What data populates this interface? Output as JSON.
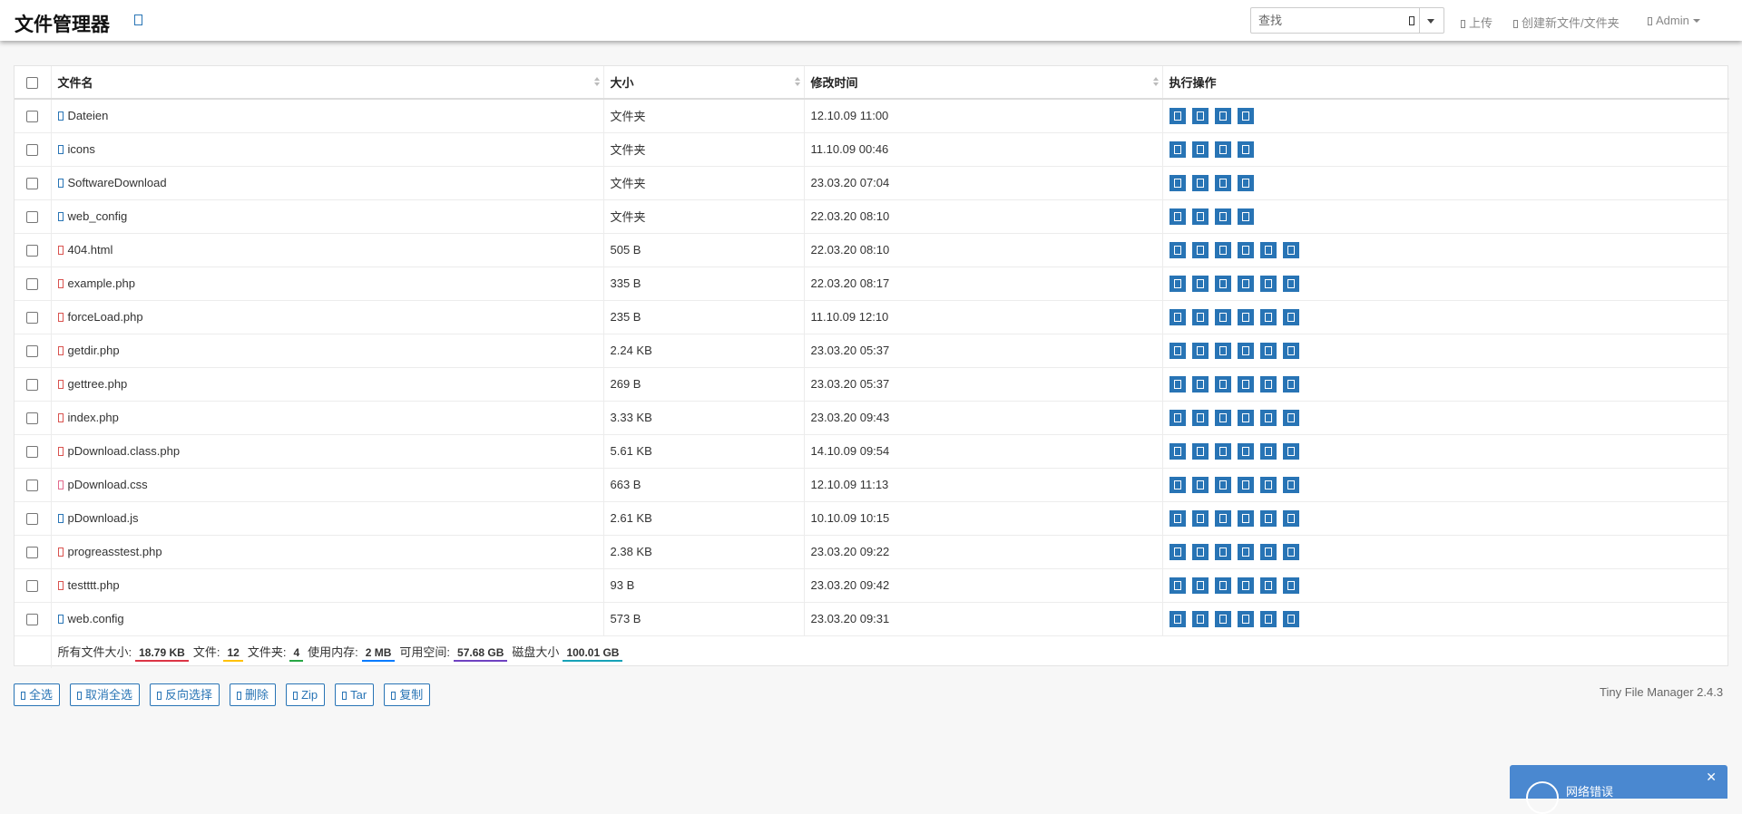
{
  "header": {
    "title": "文件管理器",
    "search_placeholder": "查找",
    "upload_label": "上传",
    "create_label": "创建新文件/文件夹",
    "user_label": "Admin"
  },
  "table": {
    "columns": {
      "name": "文件名",
      "size": "大小",
      "modified": "修改时间",
      "actions": "执行操作"
    },
    "rows": [
      {
        "name": "Dateien",
        "size": "文件夹",
        "modified": "12.10.09 11:00",
        "icon": "folder-icon",
        "icon_color": "blue",
        "actions": 4
      },
      {
        "name": "icons",
        "size": "文件夹",
        "modified": "11.10.09 00:46",
        "icon": "folder-icon",
        "icon_color": "blue",
        "actions": 4
      },
      {
        "name": "SoftwareDownload",
        "size": "文件夹",
        "modified": "23.03.20 07:04",
        "icon": "folder-icon",
        "icon_color": "blue",
        "actions": 4
      },
      {
        "name": "web_config",
        "size": "文件夹",
        "modified": "22.03.20 08:10",
        "icon": "folder-icon",
        "icon_color": "blue",
        "actions": 4
      },
      {
        "name": "404.html",
        "size": "505 B",
        "modified": "22.03.20 08:10",
        "icon": "html-file-icon",
        "icon_color": "red",
        "actions": 6
      },
      {
        "name": "example.php",
        "size": "335 B",
        "modified": "22.03.20 08:17",
        "icon": "code-file-icon",
        "icon_color": "red",
        "actions": 6
      },
      {
        "name": "forceLoad.php",
        "size": "235 B",
        "modified": "11.10.09 12:10",
        "icon": "code-file-icon",
        "icon_color": "red",
        "actions": 6
      },
      {
        "name": "getdir.php",
        "size": "2.24 KB",
        "modified": "23.03.20 05:37",
        "icon": "code-file-icon",
        "icon_color": "red",
        "actions": 6
      },
      {
        "name": "gettree.php",
        "size": "269 B",
        "modified": "23.03.20 05:37",
        "icon": "code-file-icon",
        "icon_color": "red",
        "actions": 6
      },
      {
        "name": "index.php",
        "size": "3.33 KB",
        "modified": "23.03.20 09:43",
        "icon": "code-file-icon",
        "icon_color": "red",
        "actions": 6
      },
      {
        "name": "pDownload.class.php",
        "size": "5.61 KB",
        "modified": "14.10.09 09:54",
        "icon": "code-file-icon",
        "icon_color": "red",
        "actions": 6
      },
      {
        "name": "pDownload.css",
        "size": "663 B",
        "modified": "12.10.09 11:13",
        "icon": "css-file-icon",
        "icon_color": "pink",
        "actions": 6
      },
      {
        "name": "pDownload.js",
        "size": "2.61 KB",
        "modified": "10.10.09 10:15",
        "icon": "js-file-icon",
        "icon_color": "blue",
        "actions": 6
      },
      {
        "name": "progreasstest.php",
        "size": "2.38 KB",
        "modified": "23.03.20 09:22",
        "icon": "code-file-icon",
        "icon_color": "red",
        "actions": 6
      },
      {
        "name": "testttt.php",
        "size": "93 B",
        "modified": "23.03.20 09:42",
        "icon": "code-file-icon",
        "icon_color": "red",
        "actions": 6
      },
      {
        "name": "web.config",
        "size": "573 B",
        "modified": "23.03.20 09:31",
        "icon": "config-file-icon",
        "icon_color": "blue",
        "actions": 6
      }
    ]
  },
  "summary": {
    "total_size_label": "所有文件大小:",
    "total_size": "18.79 KB",
    "files_label": "文件:",
    "files": "12",
    "folders_label": "文件夹:",
    "folders": "4",
    "memory_label": "使用内存:",
    "memory": "2 MB",
    "free_label": "可用空间:",
    "free": "57.68 GB",
    "disk_label": "磁盘大小",
    "disk": "100.01 GB",
    "badge_colors": [
      "#dc3545",
      "#ffc107",
      "#28a745",
      "#007bff",
      "#6f42c1",
      "#17a2b8"
    ]
  },
  "buttons": {
    "select_all": "全选",
    "unselect_all": "取消全选",
    "invert": "反向选择",
    "delete": "删除",
    "zip": "Zip",
    "tar": "Tar",
    "copy": "复制"
  },
  "footer": {
    "version": "Tiny File Manager 2.4.3"
  },
  "toast": {
    "message": "网络错误"
  },
  "colors": {
    "accent": "#2874b5",
    "toast": "#4a88d0"
  }
}
